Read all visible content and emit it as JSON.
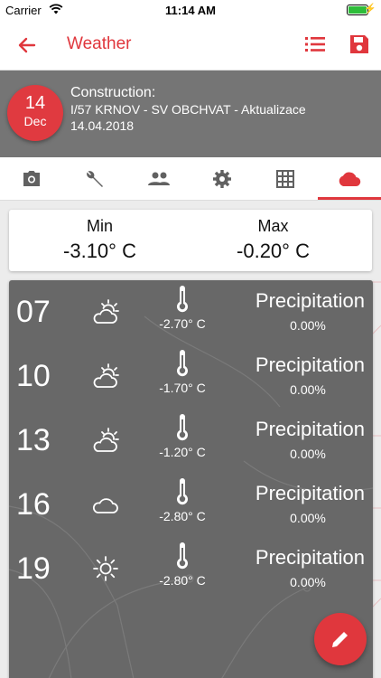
{
  "status_bar": {
    "carrier": "Carrier",
    "time": "11:14 AM"
  },
  "app_bar": {
    "title": "Weather"
  },
  "header": {
    "day": "14",
    "month": "Dec",
    "label": "Construction:",
    "project": "I/57 KRNOV - SV OBCHVAT - Aktualizace",
    "date": "14.04.2018"
  },
  "tabs": [
    {
      "icon": "camera-icon",
      "active": false
    },
    {
      "icon": "wrench-icon",
      "active": false
    },
    {
      "icon": "people-icon",
      "active": false
    },
    {
      "icon": "gear-icon",
      "active": false
    },
    {
      "icon": "grid-icon",
      "active": false
    },
    {
      "icon": "cloud-icon",
      "active": true
    }
  ],
  "summary": {
    "min_label": "Min",
    "min_value": "-3.10° C",
    "max_label": "Max",
    "max_value": "-0.20° C"
  },
  "forecast": [
    {
      "hour": "07",
      "icon": "partly-cloudy-icon",
      "temp": "-2.70° C",
      "precip_label": "Precipitation",
      "precip": "0.00%"
    },
    {
      "hour": "10",
      "icon": "partly-cloudy-icon",
      "temp": "-1.70° C",
      "precip_label": "Precipitation",
      "precip": "0.00%"
    },
    {
      "hour": "13",
      "icon": "partly-cloudy-icon",
      "temp": "-1.20° C",
      "precip_label": "Precipitation",
      "precip": "0.00%"
    },
    {
      "hour": "16",
      "icon": "cloud-icon",
      "temp": "-2.80° C",
      "precip_label": "Precipitation",
      "precip": "0.00%"
    },
    {
      "hour": "19",
      "icon": "sun-icon",
      "temp": "-2.80° C",
      "precip_label": "Precipitation",
      "precip": "0.00%"
    }
  ],
  "colors": {
    "accent": "#e0373d",
    "header_bg": "#757575",
    "panel_bg": "#686868"
  }
}
